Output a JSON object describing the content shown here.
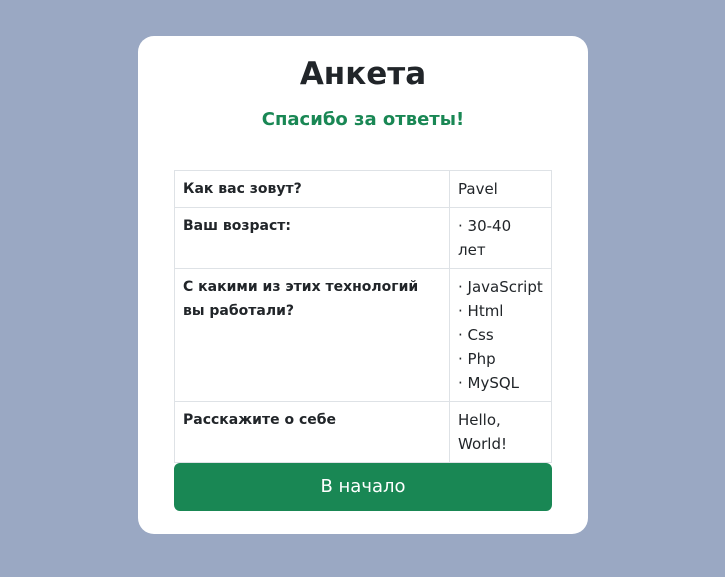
{
  "card": {
    "title": "Анкета",
    "subtitle": "Спасибо за ответы!"
  },
  "answers": {
    "rows": [
      {
        "question": "Как вас зовут?",
        "answer": "Pavel"
      },
      {
        "question": "Ваш возраст:",
        "answer": "· 30-40 лет"
      },
      {
        "question": "С какими из этих технологий вы работали?",
        "answer_list": [
          "· JavaScript",
          "· Html",
          "· Css",
          "· Php",
          "· MySQL"
        ]
      },
      {
        "question": "Расскажите о себе",
        "answer": "Hello, World!"
      }
    ]
  },
  "actions": {
    "home_label": "В начало"
  },
  "colors": {
    "background": "#9aa8c3",
    "accent": "#198754"
  }
}
